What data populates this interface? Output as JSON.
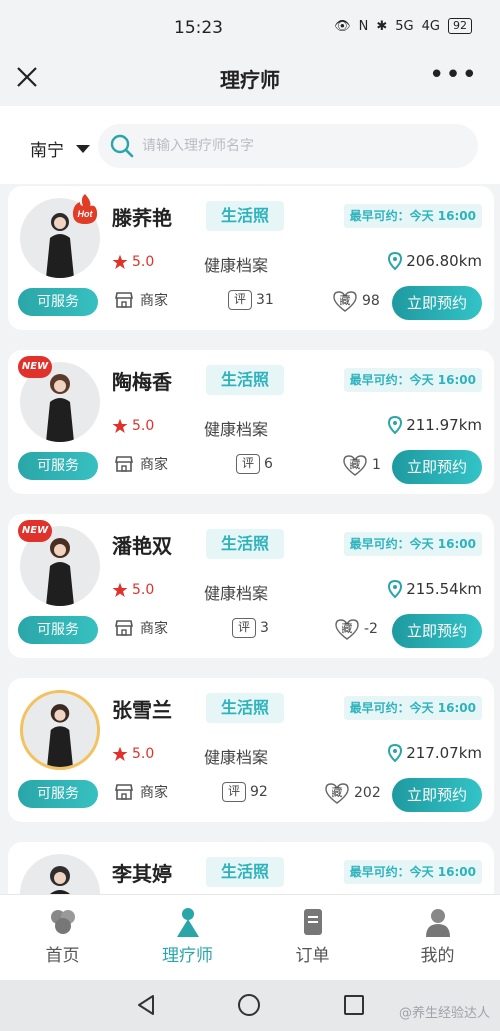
{
  "status_bar": {
    "time": "15:23",
    "network_1": "5G",
    "network_2": "4G",
    "battery": "92"
  },
  "header": {
    "title": "理疗师",
    "more": "•••"
  },
  "search": {
    "city": "南宁",
    "placeholder": "请输入理疗师名字"
  },
  "therapists": [
    {
      "name": "滕荞艳",
      "life_photo": "生活照",
      "earliest": "最早可约：今天 16:00",
      "rating": "5.0",
      "profile": "健康档案",
      "distance": "206.80km",
      "status": "可服务",
      "merchant": "商家",
      "comment_icon_text": "评",
      "comments": "31",
      "fav_icon_text": "藏",
      "favorites": "98",
      "book": "立即预约",
      "badge": "Hot"
    },
    {
      "name": "陶梅香",
      "life_photo": "生活照",
      "earliest": "最早可约：今天 16:00",
      "rating": "5.0",
      "profile": "健康档案",
      "distance": "211.97km",
      "status": "可服务",
      "merchant": "商家",
      "comment_icon_text": "评",
      "comments": "6",
      "fav_icon_text": "藏",
      "favorites": "1",
      "book": "立即预约",
      "badge": "NEW"
    },
    {
      "name": "潘艳双",
      "life_photo": "生活照",
      "earliest": "最早可约：今天 16:00",
      "rating": "5.0",
      "profile": "健康档案",
      "distance": "215.54km",
      "status": "可服务",
      "merchant": "商家",
      "comment_icon_text": "评",
      "comments": "3",
      "fav_icon_text": "藏",
      "favorites": "-2",
      "book": "立即预约",
      "badge": "NEW"
    },
    {
      "name": "张雪兰",
      "life_photo": "生活照",
      "earliest": "最早可约：今天 16:00",
      "rating": "5.0",
      "profile": "健康档案",
      "distance": "217.07km",
      "status": "可服务",
      "merchant": "商家",
      "comment_icon_text": "评",
      "comments": "92",
      "fav_icon_text": "藏",
      "favorites": "202",
      "book": "立即预约",
      "badge": ""
    },
    {
      "name": "李其婷",
      "life_photo": "生活照",
      "earliest": "最早可约：今天 16:00",
      "badge": ""
    }
  ],
  "bottom_nav": [
    {
      "label": "首页",
      "icon": "home-icon"
    },
    {
      "label": "理疗师",
      "icon": "therapist-icon",
      "active": true
    },
    {
      "label": "订单",
      "icon": "order-icon"
    },
    {
      "label": "我的",
      "icon": "profile-icon"
    }
  ],
  "watermark": "@养生经验达人",
  "colors": {
    "accent": "#2aa6a8",
    "rating": "#e0322b",
    "badge": "#e0322b",
    "avatar_ring": "#f3c15e"
  }
}
